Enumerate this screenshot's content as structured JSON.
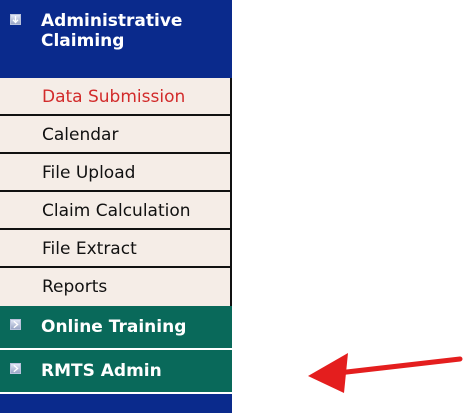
{
  "nav": {
    "admin_claiming": {
      "title": "Administrative Claiming",
      "icon": "expand-icon"
    },
    "sub_items": [
      {
        "label": "Data Submission",
        "active": true
      },
      {
        "label": "Calendar",
        "active": false
      },
      {
        "label": "File Upload",
        "active": false
      },
      {
        "label": "Claim Calculation",
        "active": false
      },
      {
        "label": "File Extract",
        "active": false
      },
      {
        "label": "Reports",
        "active": false
      }
    ],
    "online_training": {
      "label": "Online Training",
      "icon": "expand-icon"
    },
    "rmts_admin": {
      "label": "RMTS Admin",
      "icon": "expand-icon"
    }
  },
  "annotation": {
    "icon": "red-arrow",
    "color": "#e41e1e",
    "points_to": "RMTS Admin"
  },
  "colors": {
    "admin_header_bg": "#0a2a8c",
    "section_header_bg": "#09695a",
    "sub_item_bg": "#f5ede7",
    "active_text": "#d22b2b"
  }
}
